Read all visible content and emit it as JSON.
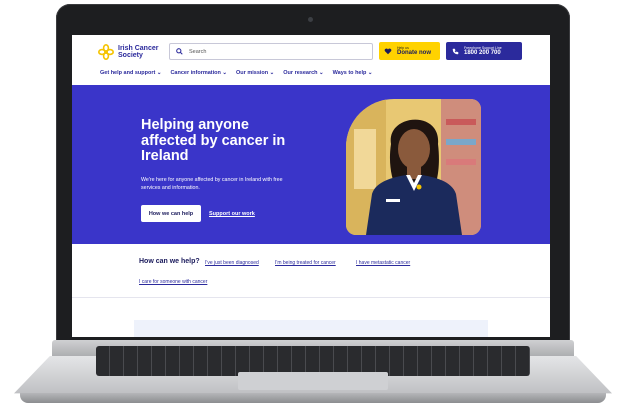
{
  "header": {
    "logo_text": "Irish Cancer\nSociety",
    "search_placeholder": "Search",
    "donate_small": "Help us",
    "donate_big": "Donate now",
    "support_small": "Freephone Support Line",
    "support_big": "1800 200 700"
  },
  "nav": {
    "items": [
      {
        "label": "Get help and support"
      },
      {
        "label": "Cancer information"
      },
      {
        "label": "Our mission"
      },
      {
        "label": "Our research"
      },
      {
        "label": "Ways to help"
      }
    ]
  },
  "hero": {
    "title": "Helping anyone affected by cancer in Ireland",
    "subtitle": "We're here for anyone affected by cancer in Ireland with free services and information.",
    "primary_button": "How we can help",
    "secondary_link": "Support our work"
  },
  "help": {
    "title": "How can we help?",
    "links": [
      "I've just been diagnosed",
      "I'm being treated for cancer",
      "I have metastatic cancer",
      "I care for someone with cancer"
    ]
  },
  "colors": {
    "brand_blue": "#3a35c9",
    "navy": "#2b2a9c",
    "donate_yellow": "#ffd200"
  }
}
